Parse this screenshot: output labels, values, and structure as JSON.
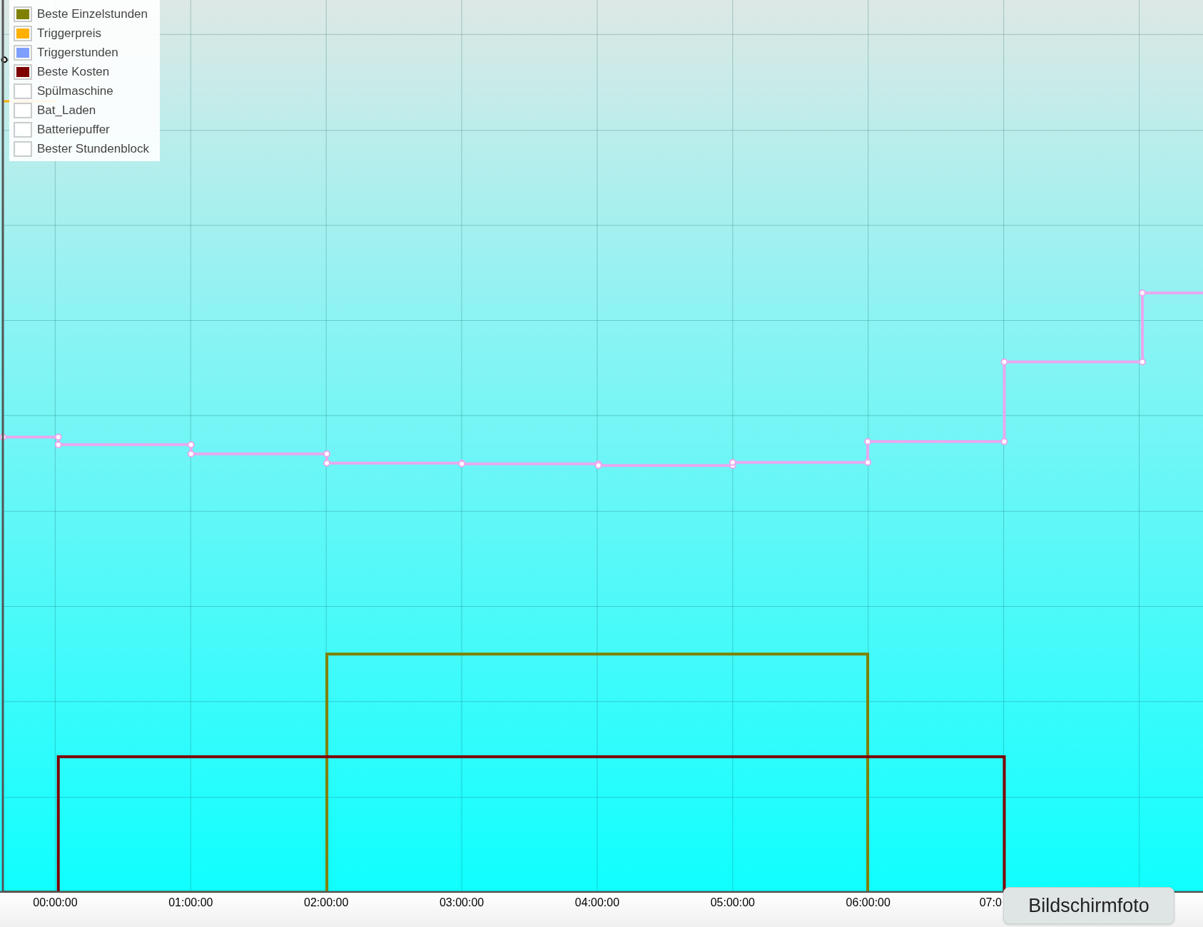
{
  "legend": {
    "items": [
      {
        "label": "Beste Einzelstunden",
        "color": "#808000"
      },
      {
        "label": "Triggerpreis",
        "color": "#ffb000"
      },
      {
        "label": "Triggerstunden",
        "color": "#7f9fff"
      },
      {
        "label": "Beste Kosten",
        "color": "#7f0000"
      },
      {
        "label": "Spülmaschine",
        "color": "#ffffff"
      },
      {
        "label": "Bat_Laden",
        "color": "#ffffff"
      },
      {
        "label": "Batteriepuffer",
        "color": "#ffffff"
      },
      {
        "label": "Bester Stundenblock",
        "color": "#ffffff"
      }
    ]
  },
  "x_axis": {
    "ticks": [
      "00:00:00",
      "01:00:00",
      "02:00:00",
      "03:00:00",
      "04:00:00",
      "05:00:00",
      "06:00:00",
      "07:0"
    ]
  },
  "tooltip": {
    "text": "Bildschirmfoto"
  }
}
